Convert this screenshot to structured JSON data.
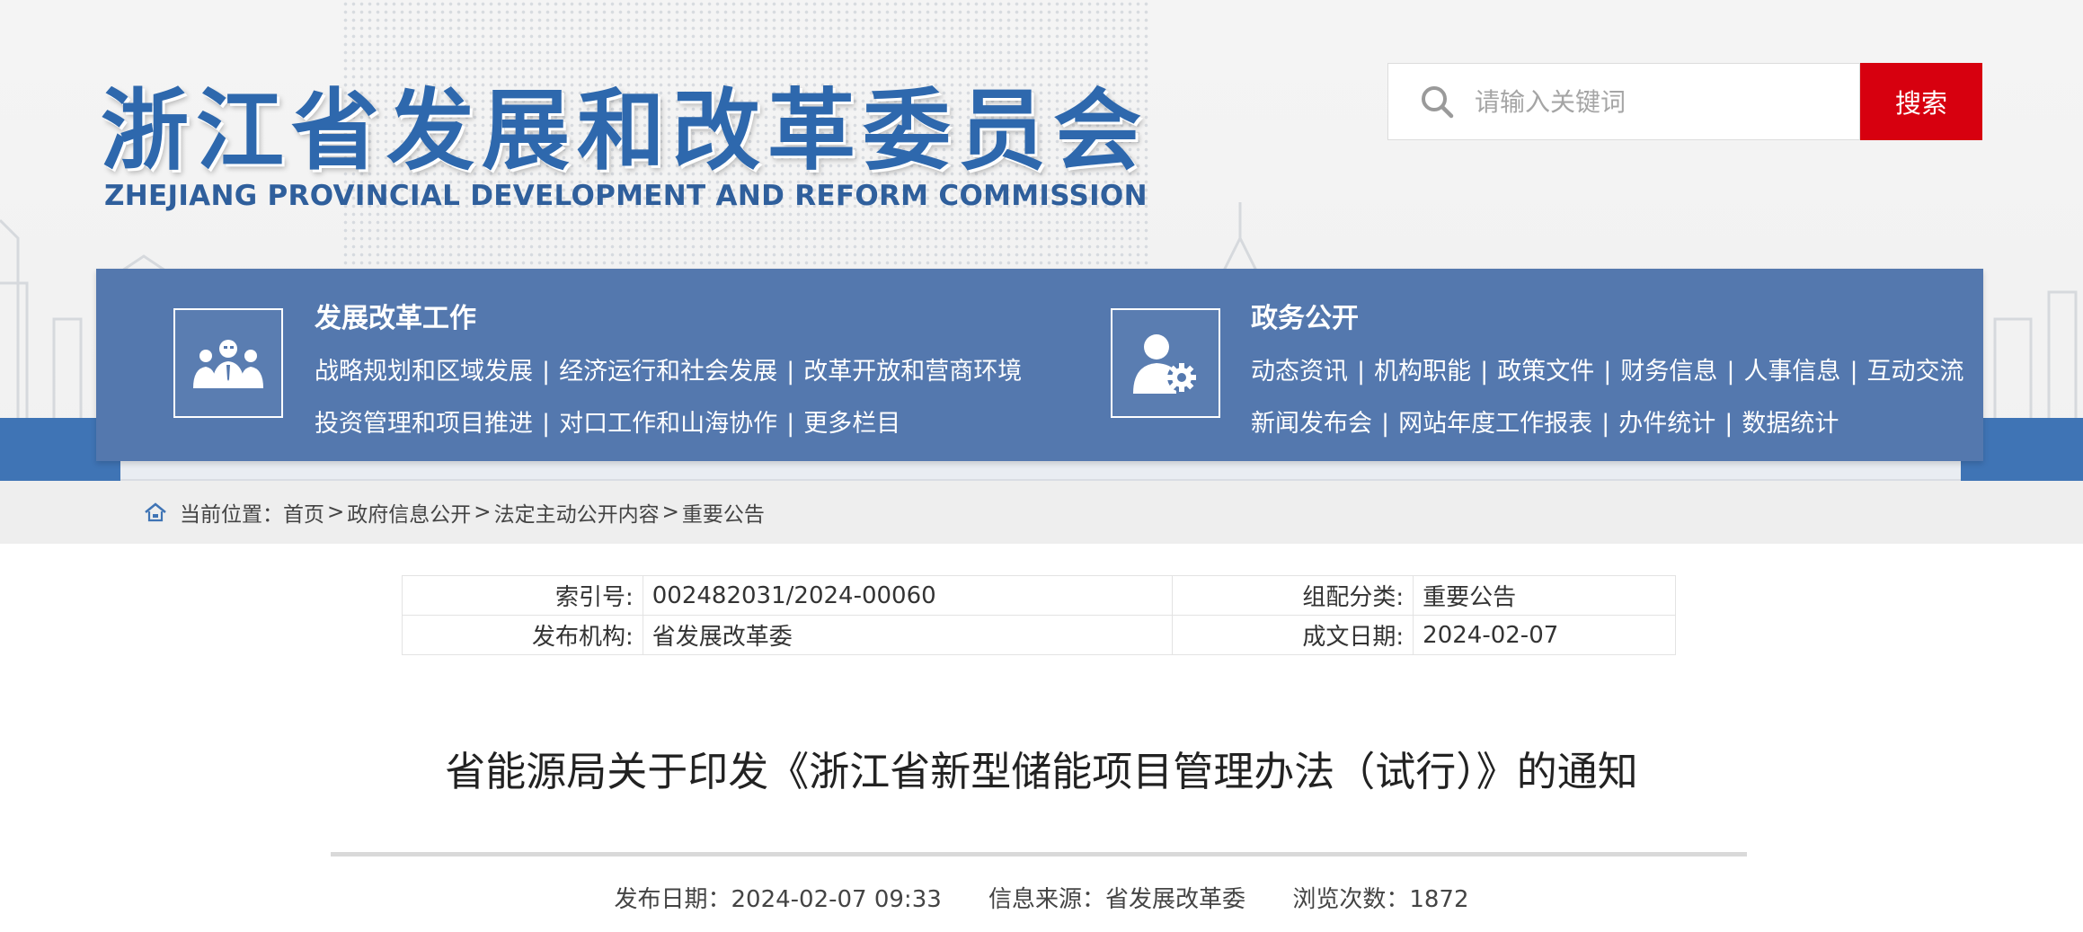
{
  "logo": {
    "title_cn": "浙江省发展和改革委员会",
    "title_en": "ZHEJIANG PROVINCIAL DEVELOPMENT AND REFORM COMMISSION"
  },
  "search": {
    "placeholder": "请输入关键词",
    "button_label": "搜索"
  },
  "nav": {
    "work": {
      "title": "发展改革工作",
      "icon": "people-group-icon",
      "row1": [
        "战略规划和区域发展",
        "经济运行和社会发展",
        "改革开放和营商环境"
      ],
      "row2": [
        "投资管理和项目推进",
        "对口工作和山海协作",
        "更多栏目"
      ]
    },
    "gov": {
      "title": "政务公开",
      "icon": "user-gear-icon",
      "row1": [
        "动态资讯",
        "机构职能",
        "政策文件",
        "财务信息",
        "人事信息",
        "互动交流"
      ],
      "row2": [
        "新闻发布会",
        "网站年度工作报表",
        "办件统计",
        "数据统计"
      ]
    },
    "separator": "|"
  },
  "breadcrumb": {
    "prefix": "当前位置：",
    "items": [
      "首页",
      "政府信息公开",
      "法定主动公开内容",
      "重要公告"
    ],
    "separator": ">"
  },
  "meta": {
    "index_label": "索引号:",
    "index_value": "002482031/2024-00060",
    "category_label": "组配分类:",
    "category_value": "重要公告",
    "org_label": "发布机构:",
    "org_value": "省发展改革委",
    "date_label": "成文日期:",
    "date_value": "2024-02-07"
  },
  "article": {
    "title": "省能源局关于印发《浙江省新型储能项目管理办法（试行）》的通知",
    "publish_date": "发布日期：2024-02-07 09:33",
    "source": "信息来源：省发展改革委",
    "views": "浏览次数：1872"
  },
  "colors": {
    "brand_blue": "#2e68ad",
    "nav_blue": "#5478ae",
    "strip_blue": "#3f74b5",
    "search_red": "#d7000f"
  }
}
